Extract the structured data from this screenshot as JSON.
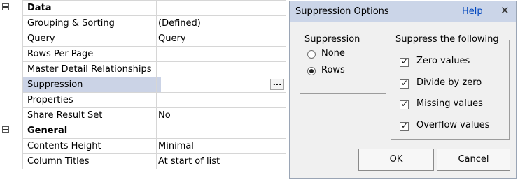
{
  "property_grid": {
    "rows": [
      {
        "name": "Data",
        "value": "",
        "category": true
      },
      {
        "name": "Grouping & Sorting",
        "value": "(Defined)"
      },
      {
        "name": "Query",
        "value": "Query"
      },
      {
        "name": "Rows Per Page",
        "value": ""
      },
      {
        "name": "Master Detail Relationships",
        "value": ""
      },
      {
        "name": "Suppression",
        "value": "",
        "selected": true,
        "has_button": true,
        "button_label": "..."
      },
      {
        "name": "Properties",
        "value": ""
      },
      {
        "name": "Share Result Set",
        "value": "No"
      },
      {
        "name": "General",
        "value": "",
        "category": true
      },
      {
        "name": "Contents Height",
        "value": "Minimal"
      },
      {
        "name": "Column Titles",
        "value": "At start of list"
      }
    ]
  },
  "dialog": {
    "title": "Suppression Options",
    "help_link": "Help",
    "close_icon": "close-icon",
    "suppression_group": {
      "legend": "Suppression",
      "options": [
        {
          "label": "None",
          "selected": false
        },
        {
          "label": "Rows",
          "selected": true
        }
      ]
    },
    "suppress_group": {
      "legend": "Suppress the following",
      "options": [
        {
          "label": "Zero values",
          "checked": true
        },
        {
          "label": "Divide by zero",
          "checked": true
        },
        {
          "label": "Missing values",
          "checked": true
        },
        {
          "label": "Overflow values",
          "checked": true
        }
      ]
    },
    "ok_label": "OK",
    "cancel_label": "Cancel"
  }
}
